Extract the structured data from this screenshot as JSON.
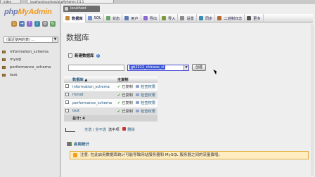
{
  "browser": {
    "tab1": "index",
    "tab2": "localhost/localhost/phpMyAdmin 3.5.1"
  },
  "logo": {
    "php": "php",
    "my": "My",
    "admin": "Admin"
  },
  "sidebar": {
    "select_value": "(最近使用的表) ...",
    "databases": [
      "information_schema",
      "mysql",
      "performance_schema",
      "test"
    ]
  },
  "header": {
    "server": "localhost"
  },
  "tabs": [
    {
      "label": "数据库",
      "color": "#c08a3a"
    },
    {
      "label": "SQL",
      "color": "#6f8fcf"
    },
    {
      "label": "状态",
      "color": "#6aa36a"
    },
    {
      "label": "用户",
      "color": "#5a7ab5"
    },
    {
      "label": "导出",
      "color": "#8a6ad0"
    },
    {
      "label": "导入",
      "color": "#7a9a3a"
    },
    {
      "label": "设置",
      "color": "#8a8a8a"
    },
    {
      "label": "同步",
      "color": "#3a8ab0"
    },
    {
      "label": "二进制日志",
      "color": "#b06a3a"
    },
    {
      "label": "更多",
      "color": "#555555"
    }
  ],
  "page": {
    "title": "数据库",
    "create_label": "新建数据库",
    "help": "?",
    "db_name_value": "",
    "collation_value": "gb2312_chinese_ci",
    "create_button": "创建"
  },
  "table": {
    "headers": {
      "database": "数据库",
      "replication": "主复制"
    },
    "rows": [
      {
        "name": "information_schema",
        "replicated": "已复制",
        "perm": "检查权限"
      },
      {
        "name": "mysql",
        "replicated": "已复制",
        "perm": "检查权限"
      },
      {
        "name": "performance_schema",
        "replicated": "已复制",
        "perm": "检查权限"
      },
      {
        "name": "test",
        "replicated": "已复制",
        "perm": "检查权限"
      }
    ],
    "total": "总计: 4"
  },
  "bulk": {
    "select_all": "全选 / 全不选",
    "with_selected": "选中项:",
    "delete": "删除"
  },
  "stats": {
    "label": "启用统计"
  },
  "notice": {
    "text": "注意: 在此启用数据库统计可能导致网站服务器和 MySQL 服务器之间的流量骤增。"
  }
}
